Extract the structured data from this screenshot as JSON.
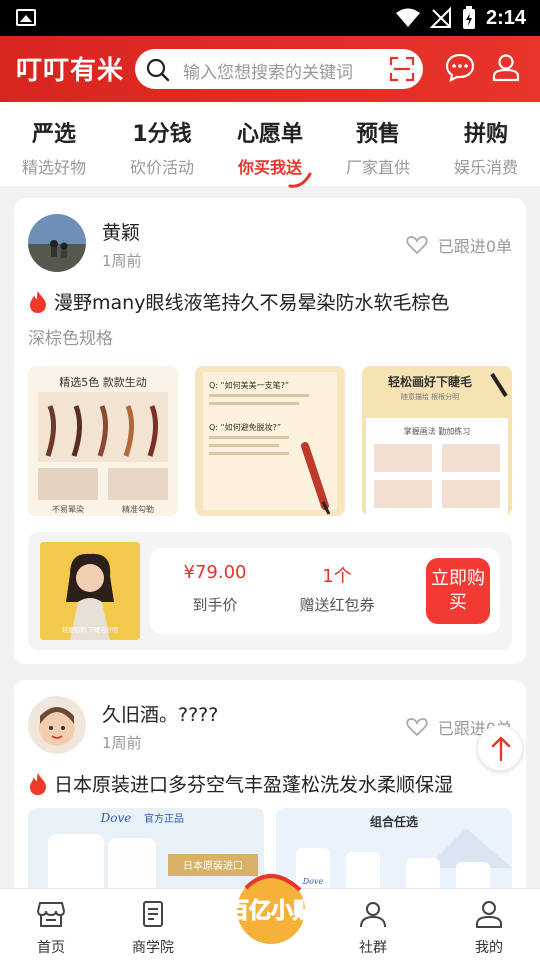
{
  "status": {
    "time": "2:14"
  },
  "header": {
    "brand": "叮叮有米",
    "search_placeholder": "输入您想搜索的关键词"
  },
  "tabs": [
    {
      "title": "严选",
      "sub": "精选好物",
      "active": false
    },
    {
      "title": "1分钱",
      "sub": "砍价活动",
      "active": false
    },
    {
      "title": "心愿单",
      "sub": "你买我送",
      "active": true
    },
    {
      "title": "预售",
      "sub": "厂家直供",
      "active": false
    },
    {
      "title": "拼购",
      "sub": "娱乐消费",
      "active": false
    }
  ],
  "posts": [
    {
      "user": "黄颖",
      "time": "1周前",
      "follow": "已跟进0单",
      "title": "漫野many眼线液笔持久不易晕染防水软毛棕色",
      "spec": "深棕色规格",
      "images": [
        {
          "caption": "精选5色 款款生动",
          "footer1": "不易晕染",
          "footer2": "精准勾勒"
        },
        {
          "q1": "Q: “如何美美一支笔?”",
          "q2": "Q: “如何避免脱妆?”"
        },
        {
          "caption": "轻松画好下睫毛",
          "sub": "随意描绘 根根分明",
          "band": "掌握画法 勤加练习"
        }
      ],
      "product": {
        "thumb_text": "轻盈勾勒 下睫毛分明",
        "price": "¥79.00",
        "price_label": "到手价",
        "gift": "1个",
        "gift_label": "赠送红包券",
        "buy": "立即购买"
      }
    },
    {
      "user": "久旧酒。????",
      "time": "1周前",
      "follow": "已跟进0单",
      "title": "日本原装进口多芬空气丰盈蓬松洗发水柔顺保湿",
      "images": [
        {
          "brand": "Dove",
          "tag": "官方正品",
          "banner": "日本原装进口"
        },
        {
          "caption": "组合任选",
          "brand": "Dove"
        }
      ]
    }
  ],
  "bottom_nav": [
    {
      "label": "首页",
      "icon": "shop-icon"
    },
    {
      "label": "商学院",
      "icon": "book-icon"
    },
    {
      "label": "百亿小贴",
      "icon": "logo"
    },
    {
      "label": "社群",
      "icon": "people-icon"
    },
    {
      "label": "我的",
      "icon": "profile-icon"
    }
  ],
  "colors": {
    "accent": "#e8342b",
    "header": "#d9251f"
  }
}
